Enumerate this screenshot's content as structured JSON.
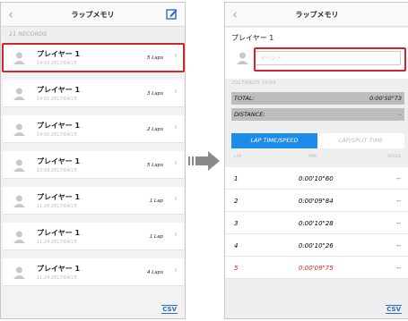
{
  "left_screen": {
    "title": "ラップメモリ",
    "back_icon": "back-chevron-icon",
    "edit_icon": "edit-icon",
    "records_count": "11 RECORDS",
    "items": [
      {
        "name": "プレイヤー 1",
        "date": "14:03 2017/04/25",
        "laps": "5 Laps"
      },
      {
        "name": "プレイヤー 1",
        "date": "14:01 2017/04/25",
        "laps": "3 Laps"
      },
      {
        "name": "プレイヤー 1",
        "date": "14:00 2017/04/25",
        "laps": "2 Laps"
      },
      {
        "name": "プレイヤー 1",
        "date": "13:59 2017/04/25",
        "laps": "5 Laps"
      },
      {
        "name": "プレイヤー 1",
        "date": "11:26 2017/04/25",
        "laps": "1 Lap"
      },
      {
        "name": "プレイヤー 1",
        "date": "11:24 2017/04/25",
        "laps": "1 Lap"
      },
      {
        "name": "プレイヤー 1",
        "date": "11:24 2017/04/25",
        "laps": "4 Laps"
      }
    ],
    "csv_label": "CSV"
  },
  "right_screen": {
    "title": "ラップメモリ",
    "back_icon": "back-chevron-icon",
    "player_name": "プレイヤー 1",
    "event_placeholder": "イベント",
    "datetime": "2017/04/25 14:03",
    "total_label": "TOTAL:",
    "total_value": "0:00'50\"73",
    "distance_label": "DISTANCE:",
    "distance_value": "--",
    "tab_lap_speed": "LAP TIME/SPEED",
    "tab_lap_split": "LAP/SPLIT TIME",
    "header_lap": "LAP",
    "header_time": "TIME",
    "header_speed": "SPEED",
    "laps": [
      {
        "no": "1",
        "time": "0:00'10\"60",
        "speed": "--"
      },
      {
        "no": "2",
        "time": "0:00'09\"84",
        "speed": "--"
      },
      {
        "no": "3",
        "time": "0:00'10\"28",
        "speed": "--"
      },
      {
        "no": "4",
        "time": "0:00'10\"26",
        "speed": "--"
      },
      {
        "no": "5",
        "time": "0:00'09\"75",
        "speed": "--"
      }
    ],
    "csv_label": "CSV"
  },
  "colors": {
    "accent": "#1d8be8",
    "highlight": "#d8232a",
    "fastest_lap": "#e02020"
  }
}
